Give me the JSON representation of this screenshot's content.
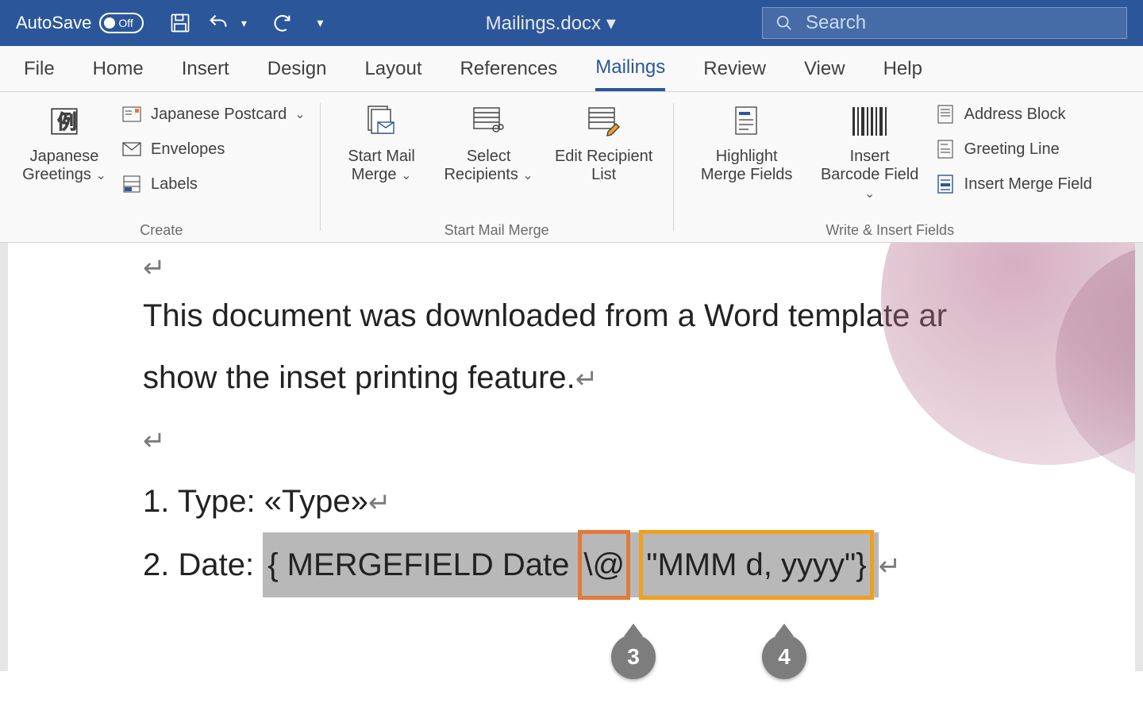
{
  "titlebar": {
    "autosave_label": "AutoSave",
    "autosave_state": "Off",
    "doc_title": "Mailings.docx ▾",
    "search_placeholder": "Search"
  },
  "tabs": [
    "File",
    "Home",
    "Insert",
    "Design",
    "Layout",
    "References",
    "Mailings",
    "Review",
    "View",
    "Help"
  ],
  "active_tab": "Mailings",
  "ribbon": {
    "groups": [
      {
        "name": "Create",
        "items": {
          "japanese_greetings": "Japanese Greetings",
          "japanese_postcard": "Japanese Postcard",
          "envelopes": "Envelopes",
          "labels": "Labels"
        }
      },
      {
        "name": "Start Mail Merge",
        "items": {
          "start_mail_merge": "Start Mail Merge",
          "select_recipients": "Select Recipients",
          "edit_recipient_list": "Edit Recipient List"
        }
      },
      {
        "name": "Write & Insert Fields",
        "items": {
          "highlight_merge_fields": "Highlight Merge Fields",
          "insert_barcode_field": "Insert Barcode Field",
          "address_block": "Address Block",
          "greeting_line": "Greeting Line",
          "insert_merge_field": "Insert Merge Field"
        }
      }
    ]
  },
  "document": {
    "para1_line1": "This document was downloaded from a Word template ar",
    "para1_line2": "show the inset printing feature.",
    "list1_label": "1. Type:  ",
    "list1_value": "«Type»",
    "list2_label": "2. Date:  ",
    "field_open": "{ MERGEFIELD Date ",
    "field_switch": "\\@",
    "field_format": " \"MMM d, yyyy\"}",
    "callouts": [
      {
        "id": "3",
        "label": "3"
      },
      {
        "id": "4",
        "label": "4"
      }
    ]
  }
}
